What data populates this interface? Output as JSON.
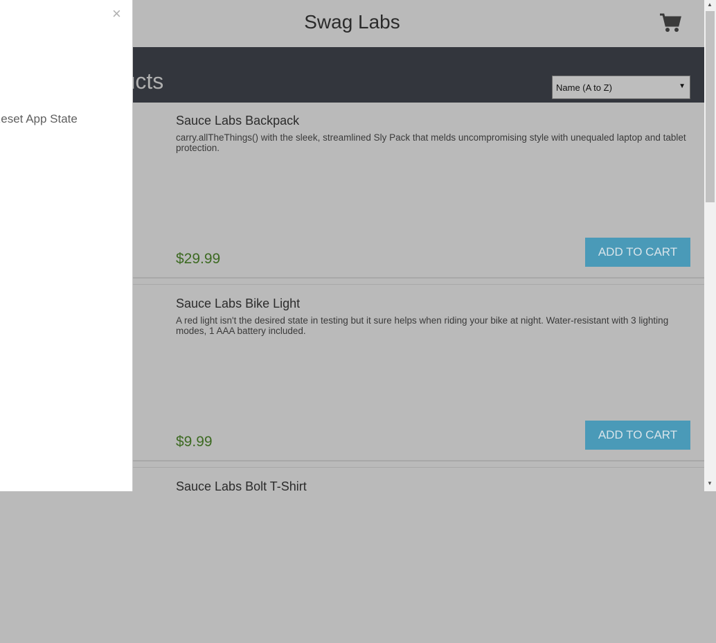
{
  "header": {
    "title": "Swag Labs",
    "cart_icon": "cart-icon"
  },
  "subheader": {
    "title": "Products",
    "sort_selected": "Name (A to Z)"
  },
  "drawer": {
    "close_label": "×",
    "items": [
      {
        "label": "Reset App State"
      }
    ]
  },
  "inventory": [
    {
      "name": "Sauce Labs Backpack",
      "description": "carry.allTheThings() with the sleek, streamlined Sly Pack that melds uncompromising style with unequaled laptop and tablet protection.",
      "price": "$29.99",
      "button": "ADD TO CART"
    },
    {
      "name": "Sauce Labs Bike Light",
      "description": "A red light isn't the desired state in testing but it sure helps when riding your bike at night. Water-resistant with 3 lighting modes, 1 AAA battery included.",
      "price": "$9.99",
      "button": "ADD TO CART"
    },
    {
      "name": "Sauce Labs Bolt T-Shirt"
    }
  ],
  "colors": {
    "accent": "#4a9ab8",
    "price": "#3d6a22",
    "subheader_bg": "#33363d"
  }
}
